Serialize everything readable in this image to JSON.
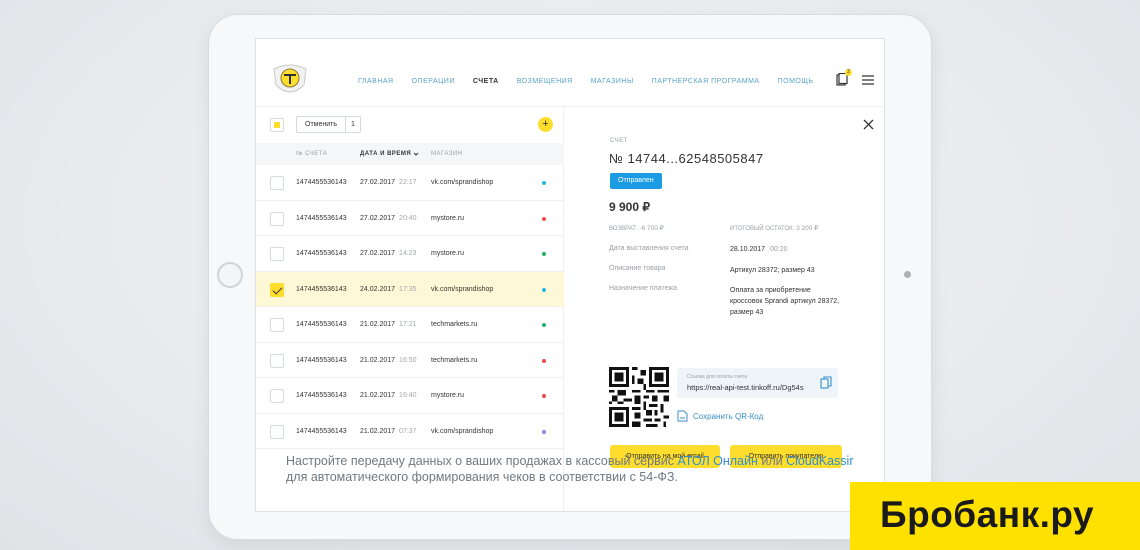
{
  "nav": {
    "items": [
      "Главная",
      "Операции",
      "Счета",
      "Возмещения",
      "Магазины",
      "Партнерская программа",
      "Помощь"
    ],
    "active_index": 2,
    "notification_count": "2"
  },
  "toolbar": {
    "cancel_label": "Отменить",
    "selected_count": "1",
    "add_label": "+"
  },
  "table": {
    "headers": [
      "№ счета",
      "Дата и время",
      "Магазин"
    ],
    "rows": [
      {
        "num": "1474455536143",
        "date": "27.02.2017",
        "time": "22:17",
        "shop": "vk.com/sprandishop",
        "status_color": "#2bb5e5",
        "selected": false
      },
      {
        "num": "1474455536143",
        "date": "27.02.2017",
        "time": "20:40",
        "shop": "mystore.ru",
        "status_color": "#ef4b4b",
        "selected": false
      },
      {
        "num": "1474455536143",
        "date": "27.02.2017",
        "time": "14:23",
        "shop": "mystore.ru",
        "status_color": "#21b26d",
        "selected": false
      },
      {
        "num": "1474455536143",
        "date": "24.02.2017",
        "time": "17:35",
        "shop": "vk.com/sprandishop",
        "status_color": "#2bb5e5",
        "selected": true
      },
      {
        "num": "1474455536143",
        "date": "21.02.2017",
        "time": "17:21",
        "shop": "techmarkets.ru",
        "status_color": "#21b26d",
        "selected": false
      },
      {
        "num": "1474455536143",
        "date": "21.02.2017",
        "time": "16:50",
        "shop": "techmarkets.ru",
        "status_color": "#ef4b4b",
        "selected": false
      },
      {
        "num": "1474455536143",
        "date": "21.02.2017",
        "time": "16:40",
        "shop": "mystore.ru",
        "status_color": "#ef4b4b",
        "selected": false
      },
      {
        "num": "1474455536143",
        "date": "21.02.2017",
        "time": "07:37",
        "shop": "vk.com/sprandishop",
        "status_color": "#8f7fe0",
        "selected": false
      }
    ]
  },
  "detail": {
    "label": "Счет",
    "number": "№ 14744...62548505847",
    "status": "Отправлен",
    "amount": "9 900 ₽",
    "refund_label": "возврат:",
    "refund_value": "-6 700 ₽",
    "balance_label": "итоговый остаток:",
    "balance_value": "3 200 ₽",
    "date_label": "Дата выставления счета",
    "date_value": "28.10.2017",
    "time_value": "00:20",
    "desc_label": "Описание товара",
    "desc_value": "Артикул 28372; размер 43",
    "purpose_label": "Назначение платежа",
    "purpose_value": "Оплата за приобретение кроссовок Sprandi артикул 28372, размер 43",
    "link_caption": "Ссылка для оплаты счета",
    "link_url": "https://real-api-test.tinkoff.ru/Dg54s",
    "save_qr": "Сохранить QR-Код",
    "send_email": "Отправить на мой email",
    "send_buyer": "Отправить покупателю"
  },
  "caption": {
    "part1": "Настройте передачу данных о ваших продажах в кассовый сервис ",
    "atol": "АТОЛ Онлайн",
    "part2": " или ",
    "cloud": "CloudKassir",
    "part3": " для автоматического формирования чеков в соответствии с 54-ФЗ."
  },
  "watermark": "Бробанк.ру",
  "colors": {
    "accent_yellow": "#ffdd2d",
    "status_blue": "#1c9be5",
    "link_blue": "#2f8fd1"
  }
}
